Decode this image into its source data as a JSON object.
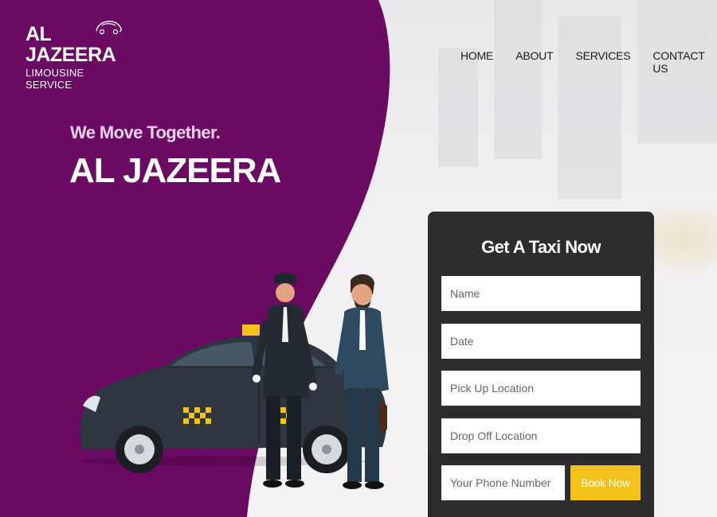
{
  "brand": {
    "title": "AL JAZEERA",
    "subtitle": "LIMOUSINE SERVICE"
  },
  "nav": {
    "items": [
      {
        "label": "HOME"
      },
      {
        "label": "ABOUT"
      },
      {
        "label": "SERVICES"
      },
      {
        "label": "CONTACT US"
      }
    ]
  },
  "hero": {
    "tagline": "We Move Together.",
    "title": "AL JAZEERA"
  },
  "booking": {
    "title": "Get A Taxi Now",
    "name_placeholder": "Name",
    "date_placeholder": "Date",
    "pickup_placeholder": "Pick Up Location",
    "dropoff_placeholder": "Drop Off Location",
    "phone_placeholder": "Your Phone Number",
    "button_label": "Book Now"
  },
  "colors": {
    "primary_purple": "#6a0a62",
    "accent_yellow": "#f2c21b",
    "panel_dark": "#2d2d2d"
  },
  "icons": [
    "logo-car-icon",
    "taxi-car-illustration",
    "chauffeur-illustration",
    "businessman-illustration"
  ]
}
